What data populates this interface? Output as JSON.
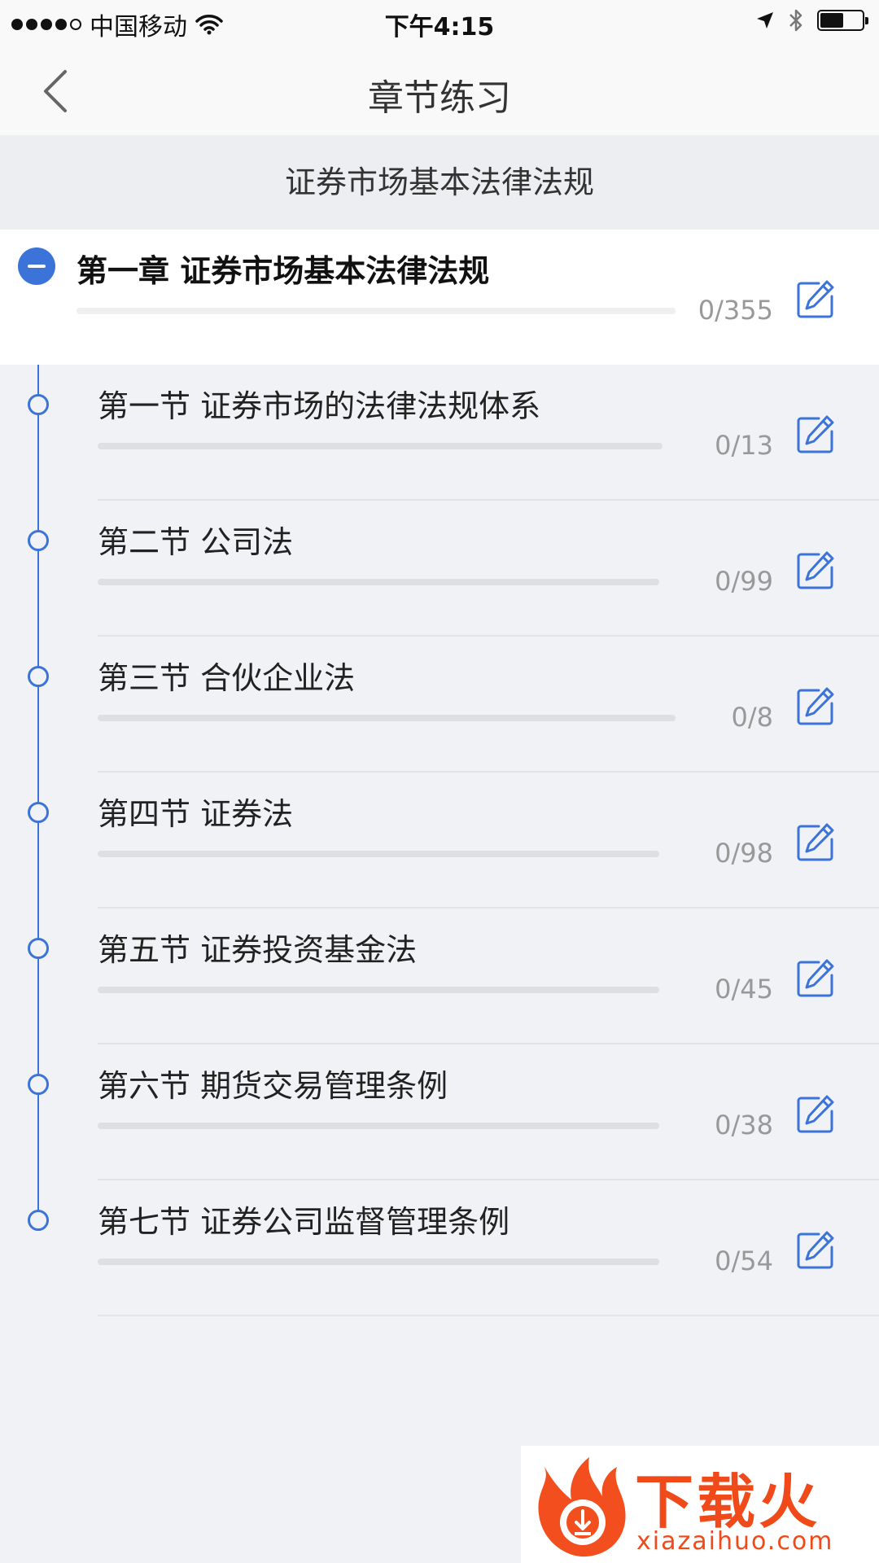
{
  "status_bar": {
    "carrier": "中国移动",
    "time": "下午4:15"
  },
  "nav": {
    "title": "章节练习"
  },
  "subject": {
    "title": "证券市场基本法律法规"
  },
  "chapter": {
    "title": "第一章 证券市场基本法律法规",
    "count": "0/355",
    "progress": 0
  },
  "sections": [
    {
      "title": "第一节 证券市场的法律法规体系",
      "count": "0/13",
      "progress": 0
    },
    {
      "title": "第二节 公司法",
      "count": "0/99",
      "progress": 0
    },
    {
      "title": "第三节 合伙企业法",
      "count": "0/8",
      "progress": 0
    },
    {
      "title": "第四节 证券法",
      "count": "0/98",
      "progress": 0
    },
    {
      "title": "第五节 证券投资基金法",
      "count": "0/45",
      "progress": 0
    },
    {
      "title": "第六节 期货交易管理条例",
      "count": "0/38",
      "progress": 0
    },
    {
      "title": "第七节 证券公司监督管理条例",
      "count": "0/54",
      "progress": 0
    }
  ],
  "watermark": {
    "name": "下载火",
    "domain": "xiazaihuo.com"
  },
  "colors": {
    "accent": "#3b73d8",
    "count_text": "#999999",
    "watermark": "#f04a1a"
  },
  "icons": {
    "back": "chevron-left-icon",
    "collapse": "minus-circle-icon",
    "edit": "edit-icon",
    "wifi": "wifi-icon",
    "location": "location-arrow-icon",
    "bluetooth": "bluetooth-icon",
    "battery": "battery-icon"
  }
}
